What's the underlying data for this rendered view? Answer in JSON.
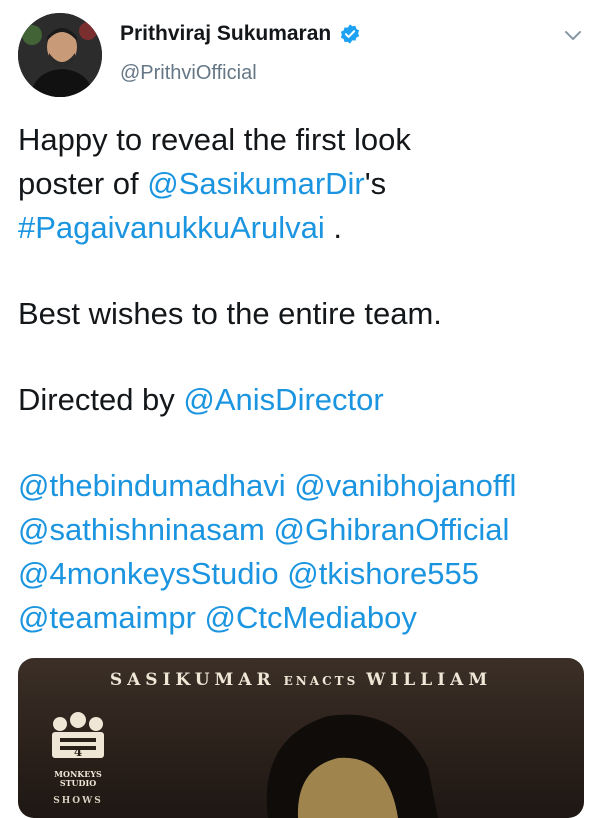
{
  "profile": {
    "display_name": "Prithviraj Sukumaran",
    "handle": "@PrithviOfficial"
  },
  "icons": {
    "avatar": "profile-photo",
    "verified": "verified-badge-icon",
    "menu": "chevron-down-icon"
  },
  "tweet": {
    "l1": "Happy to reveal the first look",
    "l2_text": "poster of ",
    "l2_mention": "@SasikumarDir",
    "l2_tail": "'s",
    "l3_hashtag": "#PagaivanukkuArulvai",
    "l3_tail": " .",
    "l4": "Best wishes to the entire team.",
    "l5_text": "Directed by ",
    "l5_mention": "@AnisDirector",
    "mentions": [
      [
        "@thebindumadhavi",
        "@vanibhojanoffl"
      ],
      [
        "@sathishninasam",
        "@GhibranOfficial"
      ],
      [
        "@4monkeysStudio",
        "@tkishore555"
      ],
      [
        "@teamaimpr",
        "@CtcMediaboy"
      ]
    ]
  },
  "media": {
    "headline_a": "SASIKUMAR",
    "headline_b": "ENACTS",
    "headline_c": "WILLIAM",
    "logo_text": "MONKEYS STUDIO",
    "logo_sub": "SHOWS"
  },
  "colors": {
    "link": "#1b95e0",
    "text": "#14171a",
    "secondary": "#657786",
    "verified": "#1da1f2"
  }
}
